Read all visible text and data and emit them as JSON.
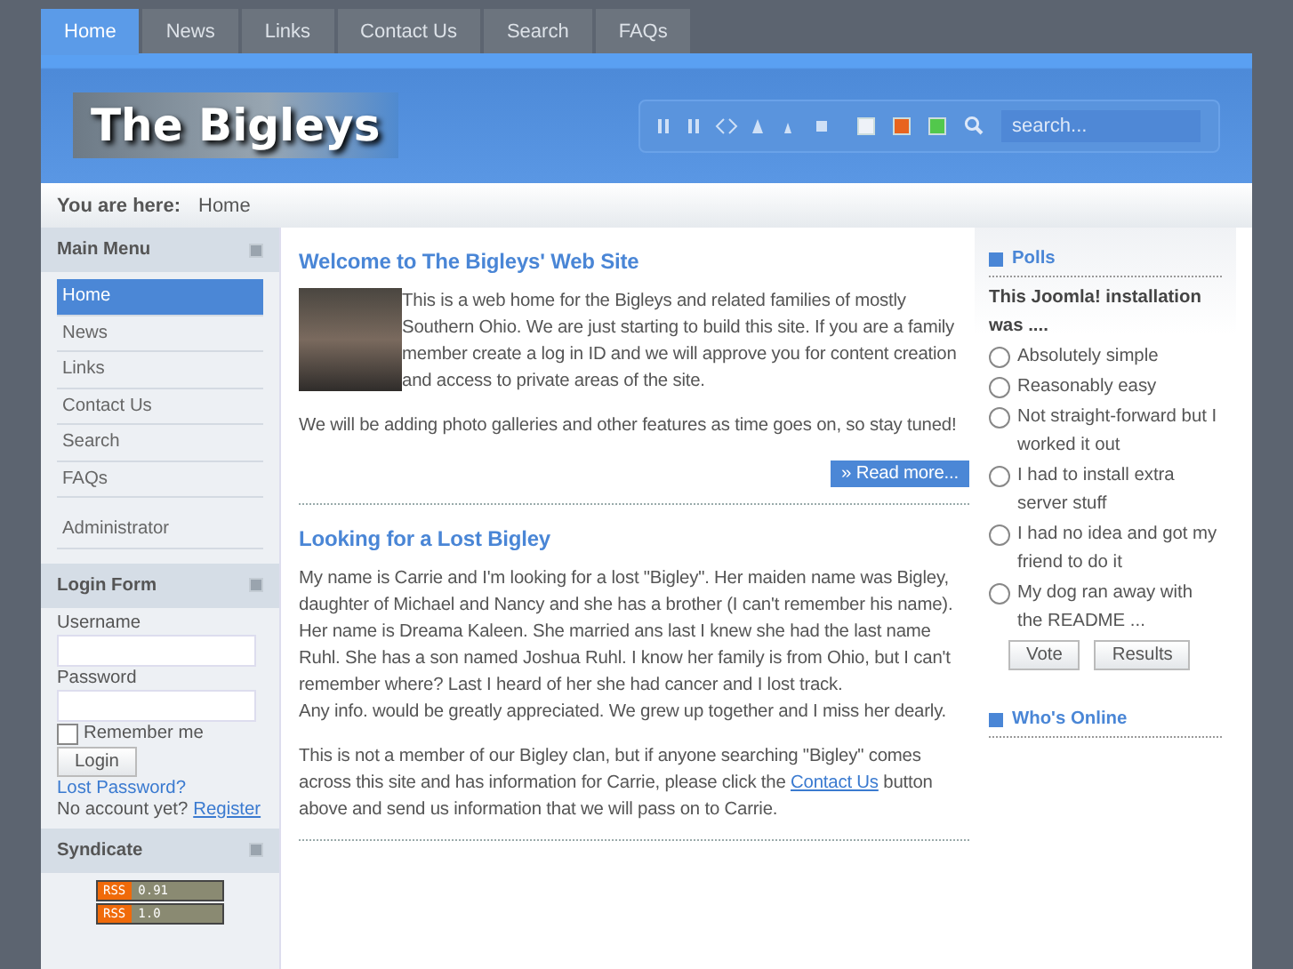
{
  "tabs": [
    {
      "label": "Home",
      "selected": true
    },
    {
      "label": "News",
      "selected": false
    },
    {
      "label": "Links",
      "selected": false
    },
    {
      "label": "Contact Us",
      "selected": false
    },
    {
      "label": "Search",
      "selected": false
    },
    {
      "label": "FAQs",
      "selected": false
    }
  ],
  "header": {
    "logo": "The Bigleys",
    "search_placeholder": "search...",
    "swatches": [
      {
        "color": "#eef2f8",
        "selected": false
      },
      {
        "color": "#e8641e",
        "selected": false
      },
      {
        "color": "#52c84c",
        "selected": false
      }
    ]
  },
  "breadcrumb": {
    "label": "You are here:",
    "current": "Home"
  },
  "main_menu": {
    "title": "Main Menu",
    "items": [
      {
        "label": "Home",
        "selected": true
      },
      {
        "label": "News",
        "selected": false
      },
      {
        "label": "Links",
        "selected": false
      },
      {
        "label": "Contact Us",
        "selected": false
      },
      {
        "label": "Search",
        "selected": false
      },
      {
        "label": "FAQs",
        "selected": false
      }
    ],
    "extra_items": [
      {
        "label": "Administrator",
        "selected": false
      }
    ]
  },
  "login_form": {
    "title": "Login Form",
    "username_label": "Username",
    "password_label": "Password",
    "remember_label": "Remember me",
    "remember_checked": false,
    "login_button": "Login",
    "lost_password": "Lost Password?",
    "no_account": "No account yet?",
    "register": "Register"
  },
  "syndicate": {
    "title": "Syndicate",
    "feeds": [
      {
        "tag": "RSS",
        "version": "0.91"
      },
      {
        "tag": "RSS",
        "version": "1.0"
      }
    ]
  },
  "articles": [
    {
      "title": "Welcome to The Bigleys' Web Site",
      "has_photo": true,
      "intro": "This is a web home for the Bigleys and related families of mostly Southern Ohio. We are just starting to build this site. If you are a family member create a log in ID and we will approve you for content creation and access to private areas of the site.",
      "paragraphs": [
        {
          "text": " We will be adding photo galleries and other features as time goes on, so stay tuned!"
        }
      ],
      "read_more_icon": "»",
      "read_more": "Read more..."
    },
    {
      "title": "Looking for a Lost Bigley",
      "has_photo": false,
      "paragraphs": [
        {
          "text": "My name is Carrie and I'm looking for a lost \"Bigley\". Her maiden name was Bigley, daughter of Michael and Nancy and she has a brother (I can't remember his name). Her name is Dreama Kaleen. She married ans last I knew she had the last name Ruhl. She has a son named Joshua Ruhl. I know her family is from Ohio, but I can't remember where? Last I heard of her she had cancer and I lost track.\nAny info. would be greatly appreciated. We grew up together and I miss her dearly."
        },
        {
          "text": "This is not a member of our Bigley clan, but if anyone searching \"Bigley\" comes across this site and has information for Carrie, please click the",
          "link": "Contact Us",
          "after": "button above and send us information that we will pass on to Carrie."
        }
      ]
    }
  ],
  "polls": {
    "title": "Polls",
    "question": "This Joomla! installation was ....",
    "options": [
      {
        "label": "Absolutely simple",
        "selected": false
      },
      {
        "label": "Reasonably easy",
        "selected": false
      },
      {
        "label": "Not straight-forward but I worked it out",
        "selected": false
      },
      {
        "label": "I had to install extra server stuff",
        "selected": false
      },
      {
        "label": "I had no idea and got my friend to do it",
        "selected": false
      },
      {
        "label": "My dog ran away with the README ...",
        "selected": false
      }
    ],
    "vote": "Vote",
    "results": "Results"
  },
  "whos_online": {
    "title": "Who's Online"
  }
}
